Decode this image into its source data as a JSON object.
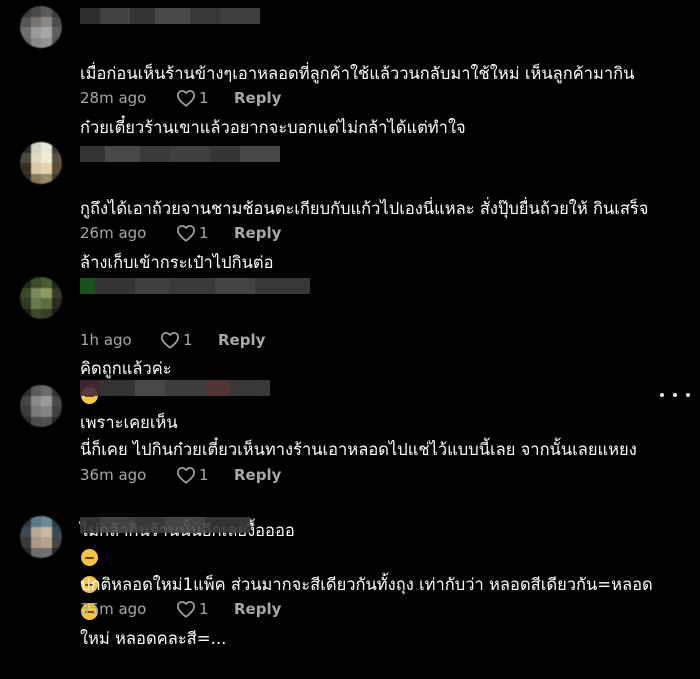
{
  "comments": [
    {
      "text_line1": "เมื่อก่อนเห็นร้านข้างๆเอาหลอดที่ลูกค้าใช้แล้ววนกลับมาใช้ใหม่ เห็นลูกค้ามากิน",
      "text_line2": "ก๋วยเตี๋ยวร้านเขาแล้วอยากจะบอกแต่ไม่กล้าได้แต่ทำใจ",
      "time": "28m ago",
      "likes": "1",
      "reply": "Reply"
    },
    {
      "text_line1": "กูถึงได้เอาถ้วยจานชามช้อนตะเกียบกับแก้วไปเองนี่แหละ สั่งปุ๊บยื่นถ้วยให้ กินเสร็จ",
      "text_line2": "ล้างเก็บเข้ากระเป๋าไปกินต่อ",
      "time": "26m ago",
      "likes": "1",
      "reply": "Reply"
    },
    {
      "text_before_emoji": "คิดถูกแล้วค่ะ",
      "text_after_emoji": "เพราะเคยเห็น",
      "time": "1h ago",
      "likes": "1",
      "reply": "Reply"
    },
    {
      "text_line1": "นี่ก็เคย ไปกินก๋วยเตี๋ยวเห็นทางร้านเอาหลอดไปแช่ไว้แบบนี้เลย จากนั้นเลยแหยง",
      "text_line2": "ไม่กล้ากินร้านนั้นอีกเลยงื้ออออ",
      "time": "36m ago",
      "likes": "1",
      "reply": "Reply"
    },
    {
      "text_line1": "ปกติหลอดใหม่1แพ็ค ส่วนมากจะสีเดียวกันทั้งถุง เท่ากับว่า หลอดสีเดียวกัน=หลอด",
      "text_line2": "ใหม่ หลอดคละสี=...",
      "time": "35m ago",
      "likes": "1",
      "reply": "Reply"
    }
  ],
  "icons": {
    "like": "heart-outline-icon",
    "more": "more-options-icon",
    "emoji_laugh": "laughing-emoji-icon",
    "emoji_neutral": "neutral-face-emoji-icon"
  },
  "colors": {
    "background": "#000000",
    "text": "#ffffff",
    "meta": "#a8a8a8"
  }
}
